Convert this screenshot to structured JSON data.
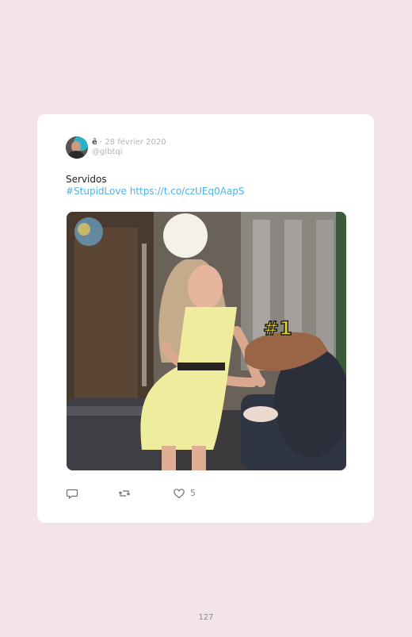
{
  "tweet": {
    "display_name": "ê",
    "date": "· 28 février 2020",
    "handle": "@glbtqi",
    "text": "Servidos",
    "hashtag": "#StupidLove",
    "link": "https://t.co/czUEq0AapS",
    "media_overlay_text": "#1",
    "actions": {
      "reply_icon": "reply-icon",
      "retweet_icon": "retweet-icon",
      "like_icon": "heart-icon",
      "like_count": "5"
    }
  },
  "page_number": "127",
  "colors": {
    "page_background": "#f3e4e8",
    "card_background": "#ffffff",
    "link": "#4fb1e6",
    "muted": "#b7b4b5"
  }
}
